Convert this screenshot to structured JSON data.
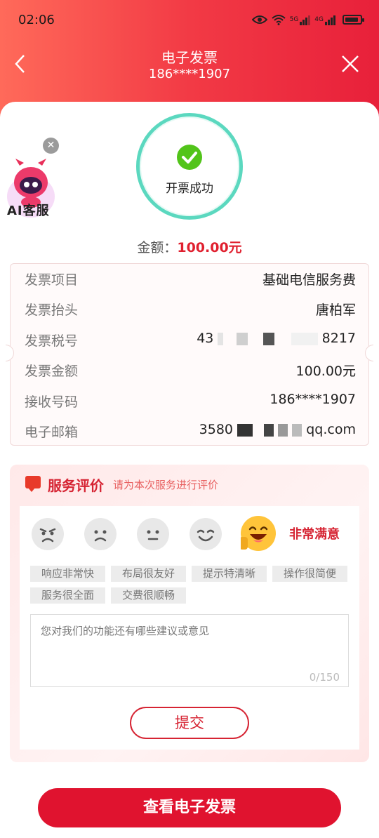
{
  "status_bar": {
    "time": "02:06",
    "net_5g": "5G",
    "net_4g": "4G"
  },
  "header": {
    "title": "电子发票",
    "phone": "186****1907"
  },
  "success": {
    "text": "开票成功"
  },
  "ai_service": {
    "label": "AI客服"
  },
  "amount": {
    "label": "金额：",
    "value": "100.00元"
  },
  "invoice_info": [
    {
      "key": "发票项目",
      "value": "基础电信服务费"
    },
    {
      "key": "发票抬头",
      "value": "唐柏军"
    },
    {
      "key": "发票税号",
      "value_prefix": "43",
      "value_suffix": "8217"
    },
    {
      "key": "发票金额",
      "value": "100.00元"
    },
    {
      "key": "接收号码",
      "value": "186****1907"
    },
    {
      "key": "电子邮箱",
      "value_prefix": "3580",
      "value_suffix": "qq.com"
    }
  ],
  "rating": {
    "title": "服务评价",
    "subtitle": "请为本次服务进行评价",
    "selected_text": "非常满意",
    "selected_level": 5,
    "faces": [
      "angry-face-icon",
      "frown-face-icon",
      "neutral-face-icon",
      "smile-face-icon",
      "grin-face-icon"
    ],
    "tags": [
      "响应非常快",
      "布局很友好",
      "提示特清晰",
      "操作很简便",
      "服务很全面",
      "交费很顺畅"
    ],
    "comment_placeholder": "您对我们的功能还有哪些建议或意见",
    "comment_count": "0/150",
    "submit_label": "提交"
  },
  "footer": {
    "view_label": "查看电子发票"
  },
  "colors": {
    "brand_red": "#e0132f",
    "success_green": "#52c41a",
    "ring_teal": "#5bd8bf"
  }
}
